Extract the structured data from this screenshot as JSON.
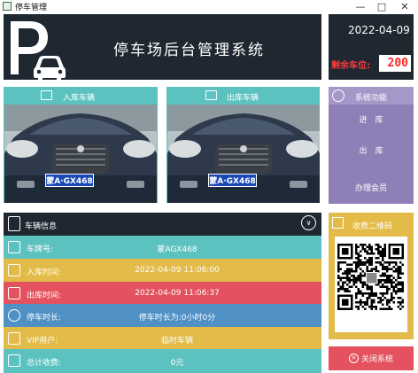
{
  "window": {
    "title": "停车管理"
  },
  "header": {
    "title": "停车场后台管理系统"
  },
  "status": {
    "date": "2022-04-09",
    "spaces_label": "剩余车位:",
    "spaces_value": "200"
  },
  "cameras": [
    {
      "label": "入库车辆",
      "plate": "蒙A·GX468"
    },
    {
      "label": "出库车辆",
      "plate": "蒙A·GX468"
    }
  ],
  "functions": {
    "title": "系统功能",
    "items": [
      "进　库",
      "出　库",
      "办理会员"
    ]
  },
  "vehicle_info": {
    "title": "车辆信息",
    "rows": [
      {
        "label": "车牌号:",
        "value": "蒙AGX468",
        "color": "#5cc2c0",
        "icon": "plate-icon"
      },
      {
        "label": "入库时间:",
        "value": "2022-04-09 11:06:00",
        "color": "#e2bb48",
        "icon": "enter-icon"
      },
      {
        "label": "出库时间:",
        "value": "2022-04-09 11:06:37",
        "color": "#e3525e",
        "icon": "exit-icon"
      },
      {
        "label": "停车时长:",
        "value": "停车时长为:0小时0分",
        "color": "#4f90c5",
        "icon": "clock-icon"
      },
      {
        "label": "VIP用户:",
        "value": "临时车辆",
        "color": "#e2bb48",
        "icon": "crown-icon"
      },
      {
        "label": "总计收费:",
        "value": "0元",
        "color": "#5cc2c0",
        "icon": "money-icon"
      }
    ]
  },
  "qr": {
    "title": "收费二维码"
  },
  "close_button": {
    "label": "关闭系统"
  }
}
